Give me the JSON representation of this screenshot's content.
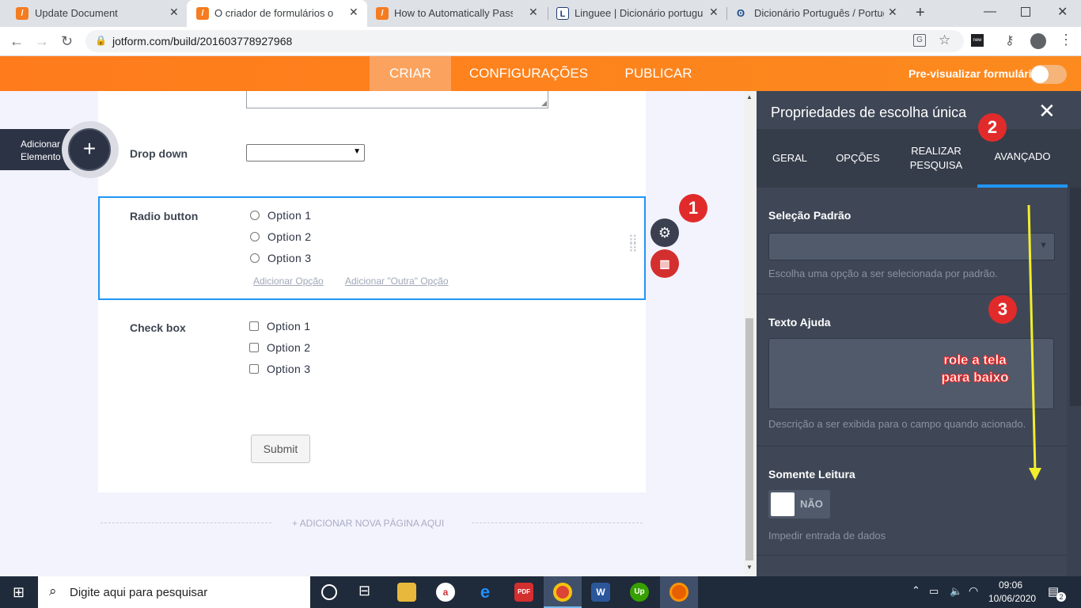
{
  "browser": {
    "tabs": [
      {
        "title": "Update Document",
        "active": false
      },
      {
        "title": "O criador de formulários online",
        "active": true
      },
      {
        "title": "How to Automatically Pass For",
        "active": false
      },
      {
        "title": "Linguee | Dicionário português",
        "active": false
      },
      {
        "title": "Dicionário Português / Portugu",
        "active": false
      }
    ],
    "url": "jotform.com/build/201603778927968"
  },
  "jotform_header": {
    "nav": [
      "CRIAR",
      "CONFIGURAÇÕES",
      "PUBLICAR"
    ],
    "preview_label": "Pre-visualizar formulário"
  },
  "add_element": {
    "line1": "Adicionar",
    "line2": "Elemento"
  },
  "form": {
    "dropdown": {
      "label": "Drop down"
    },
    "radio": {
      "label": "Radio button",
      "options": [
        "Option 1",
        "Option 2",
        "Option 3"
      ],
      "add_option": "Adicionar Opção",
      "add_other": "Adicionar \"Outra\" Opção"
    },
    "checkbox": {
      "label": "Check box",
      "options": [
        "Option 1",
        "Option 2",
        "Option 3"
      ]
    },
    "submit": "Submit",
    "add_page": "+ ADICIONAR NOVA PÁGINA AQUI"
  },
  "panel": {
    "title": "Propriedades de escolha única",
    "tabs": [
      "GERAL",
      "OPÇÕES",
      "REALIZAR PESQUISA",
      "AVANÇADO"
    ],
    "default_selection": {
      "heading": "Seleção Padrão",
      "desc": "Escolha uma opção a ser selecionada por padrão."
    },
    "help_text": {
      "heading": "Texto Ajuda",
      "desc": "Descrição a ser exibida para o campo quando acionado."
    },
    "read_only": {
      "heading": "Somente Leitura",
      "toggle": "NÃO",
      "desc": "Impedir entrada de dados"
    }
  },
  "annotations": {
    "badge1": "1",
    "badge2": "2",
    "badge3": "3",
    "scroll_note_1": "role a tela",
    "scroll_note_2": "para baixo"
  },
  "taskbar": {
    "search_placeholder": "Digite aqui para pesquisar",
    "time": "09:06",
    "date": "10/06/2020",
    "notifications": "2"
  },
  "colors": {
    "jotform_orange": "#ff7b1c",
    "panel_bg": "#3f4756",
    "selected_border": "#2196f3",
    "badge_red": "#e12b2b",
    "arrow_yellow": "#f2ee2c"
  }
}
